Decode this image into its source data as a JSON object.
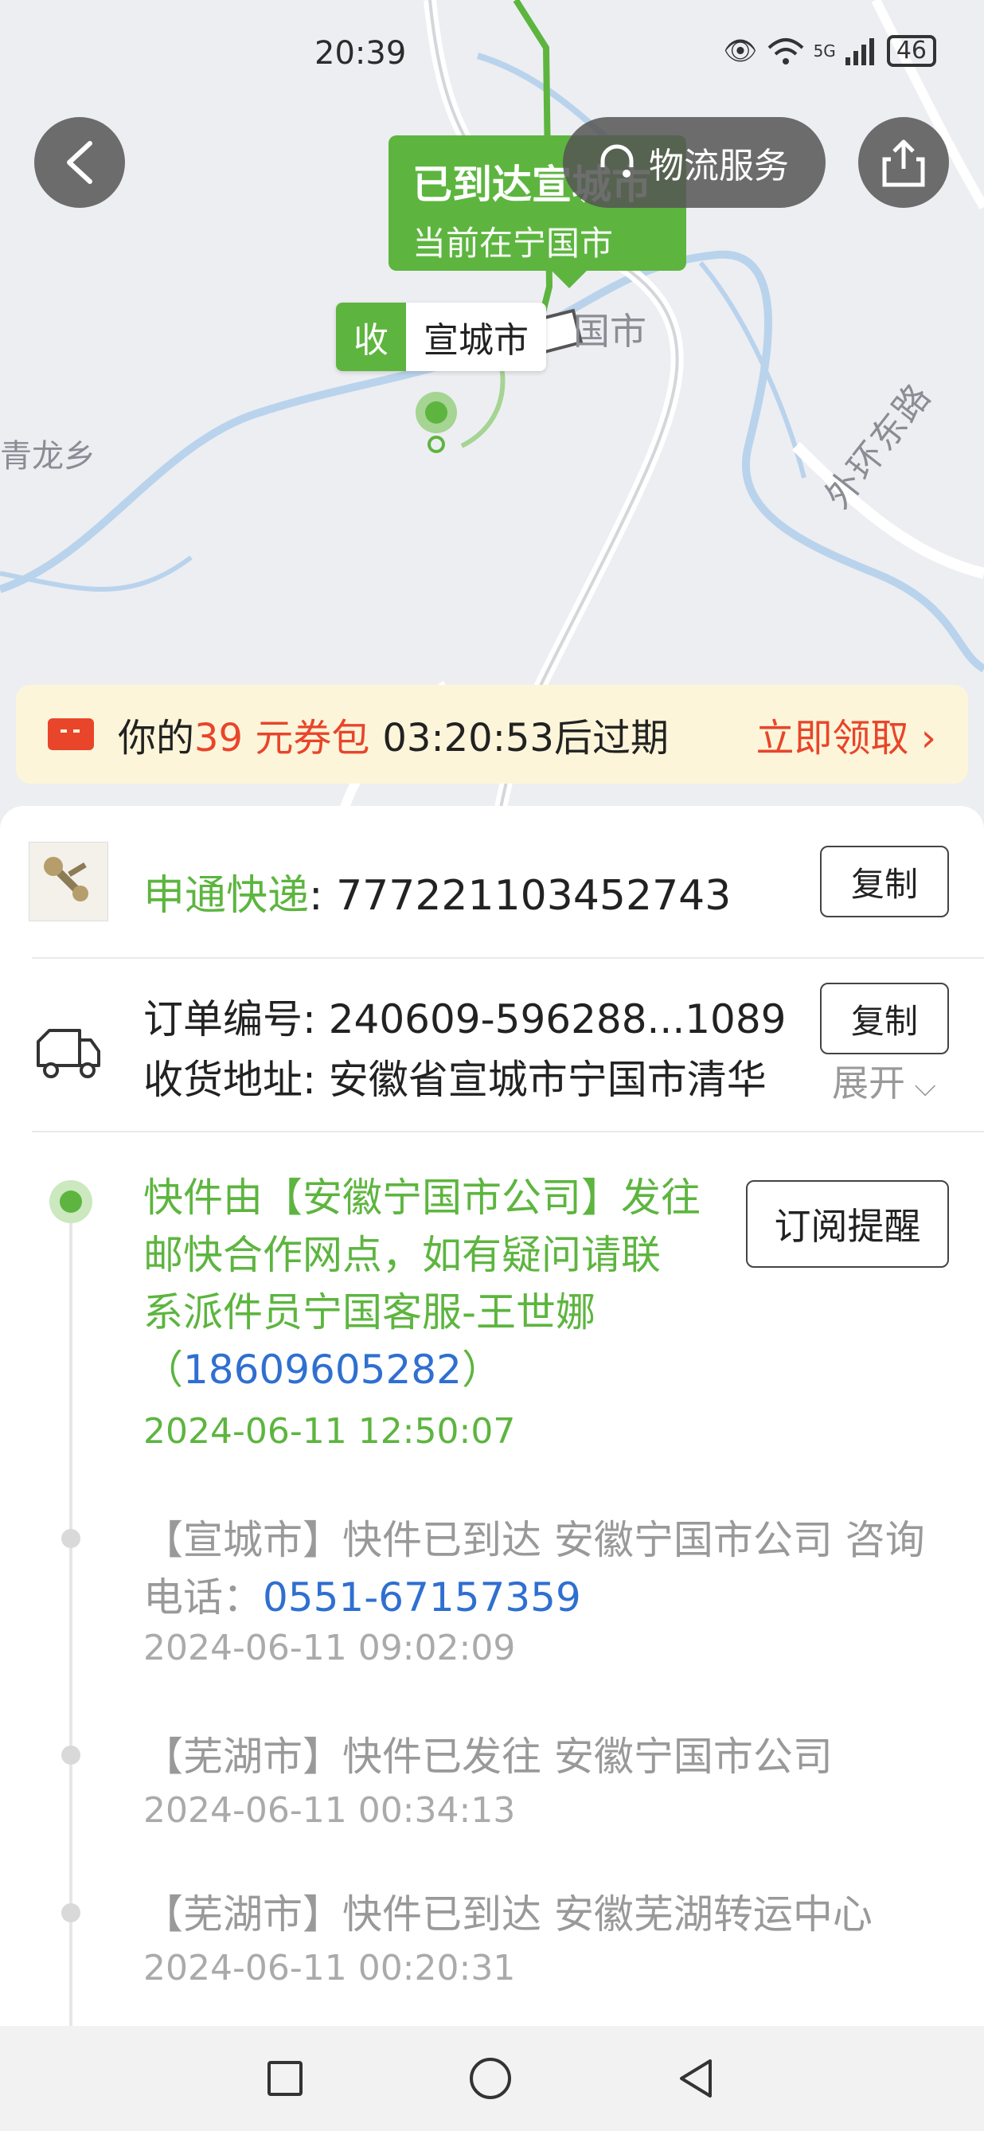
{
  "status_bar": {
    "time": "20:39",
    "battery": "46",
    "network": "5G"
  },
  "map": {
    "labels": {
      "qinglong": "青龙乡",
      "ring_road": "外环东路",
      "city_fragment": "国市"
    },
    "status_bubble": {
      "title": "已到达宣城市",
      "subtitle": "当前在宁国市"
    },
    "receive_tag": {
      "tag": "收",
      "city": "宣城市"
    },
    "logistics_button": "物流服务"
  },
  "coupon": {
    "prefix": "你的",
    "amount": "39 元券包",
    "countdown": "03:20:53后过期",
    "action": "立即领取"
  },
  "shipment": {
    "courier_name": "申通快递",
    "tracking_number": ": 777221103452743",
    "copy_label": "复制",
    "order_label": "订单编号: ",
    "order_number": "240609-596288...1089",
    "address_label": "收货地址: ",
    "address": "安徽省宣城市宁国市清华",
    "expand_label": "展开"
  },
  "timeline": {
    "subscribe_label": "订阅提醒",
    "events": [
      {
        "line1": "快件由【安徽宁国市公司】发往",
        "line2": "邮快合作网点，如有疑问请联",
        "line3": "系派件员宁国客服-王世娜",
        "phone": "18609605282",
        "time": "2024-06-11 12:50:07"
      },
      {
        "line1": "【宣城市】快件已到达 安徽宁国市公司 咨询",
        "line2_prefix": "电话：",
        "phone": "0551-67157359",
        "time": "2024-06-11 09:02:09"
      },
      {
        "line1": "【芜湖市】快件已发往 安徽宁国市公司",
        "time": "2024-06-11 00:34:13"
      },
      {
        "line1": "【芜湖市】快件已到达 安徽芜湖转运中心",
        "time": "2024-06-11 00:20:31"
      }
    ]
  },
  "colors": {
    "accent_green": "#5db53f",
    "coupon_red": "#e8452b",
    "link_blue": "#2f6fd0"
  }
}
